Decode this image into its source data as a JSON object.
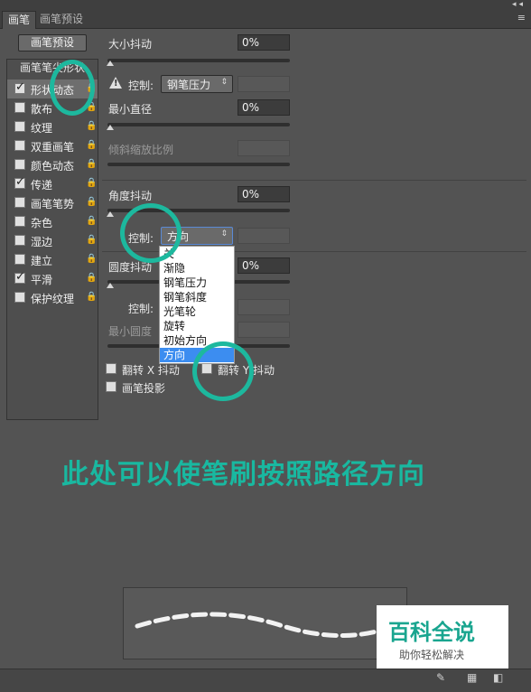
{
  "tabs": {
    "brush": "画笔",
    "brush_presets": "画笔预设"
  },
  "top_controls": "◂◂",
  "panel_menu": "≡",
  "preset_button": "画笔预设",
  "left_header": "画笔笔尖形状",
  "left_items": [
    {
      "label": "形状动态",
      "checked": true
    },
    {
      "label": "散布",
      "checked": false
    },
    {
      "label": "纹理",
      "checked": false
    },
    {
      "label": "双重画笔",
      "checked": false
    },
    {
      "label": "颜色动态",
      "checked": false
    },
    {
      "label": "传递",
      "checked": true
    },
    {
      "label": "画笔笔势",
      "checked": false
    },
    {
      "label": "杂色",
      "checked": false
    },
    {
      "label": "湿边",
      "checked": false
    },
    {
      "label": "建立",
      "checked": false
    },
    {
      "label": "平滑",
      "checked": true
    },
    {
      "label": "保护纹理",
      "checked": false
    }
  ],
  "lock_glyph": "🔒",
  "size_jitter": {
    "label": "大小抖动",
    "value": "0%"
  },
  "control1": {
    "label": "控制:",
    "value": "钢笔压力",
    "warn": "!"
  },
  "min_diameter": {
    "label": "最小直径",
    "value": "0%"
  },
  "tilt_scale": {
    "label": "倾斜缩放比例"
  },
  "angle_jitter": {
    "label": "角度抖动",
    "value": "0%"
  },
  "control2": {
    "label": "控制:",
    "value": "方向"
  },
  "roundness_jitter": {
    "label": "圆度抖动",
    "value": "0%"
  },
  "control3": {
    "label": "控制:"
  },
  "min_roundness": {
    "label": "最小圆度"
  },
  "dropdown_options": [
    "关",
    "渐隐",
    "钢笔压力",
    "钢笔斜度",
    "光笔轮",
    "旋转",
    "初始方向",
    "方向"
  ],
  "dropdown_selected": "方向",
  "flip_x": "翻转 X 抖动",
  "flip_y": "翻转 Y 抖动",
  "brush_projection": "画笔投影",
  "annotation": "此处可以使笔刷按照路径方向",
  "watermark": {
    "title": "百科全说",
    "subtitle": "助你轻松解决"
  },
  "arrow_glyph": "⇕",
  "colors": {
    "accent": "#1db89e",
    "highlight": "#3c8df0",
    "panel": "#535353"
  }
}
